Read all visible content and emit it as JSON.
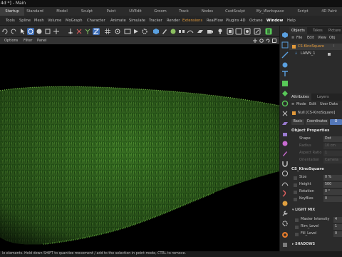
{
  "window": {
    "title": "4d *] - Main"
  },
  "layout_tabs": [
    {
      "label": "Startup",
      "active": true
    },
    {
      "label": "Standard"
    },
    {
      "label": "Model"
    },
    {
      "label": "Sculpt"
    },
    {
      "label": "Paint"
    },
    {
      "label": "UVEdit"
    },
    {
      "label": "Groom"
    },
    {
      "label": "Track"
    },
    {
      "label": "Nodes"
    },
    {
      "label": "CustSculpt"
    },
    {
      "label": "My_Workspace",
      "italic": true
    },
    {
      "label": "Script"
    },
    {
      "label": "4D Paint"
    }
  ],
  "menus": [
    "Tools",
    "Spline",
    "Mesh",
    "Volume",
    "MoGraph",
    "Character",
    "Animate",
    "Simulate",
    "Tracker",
    "Render",
    "Extensions",
    "RealFlow",
    "Plugins 4D",
    "Octane",
    "Window",
    "Help"
  ],
  "viewport": {
    "menu": [
      "Options",
      "Filter",
      "Panel"
    ]
  },
  "status": {
    "text": "le elements. Hold down SHIFT to quantize movement / add to the selection in point mode, CTRL to remove."
  },
  "objects_panel": {
    "tabs": [
      "Objects",
      "Takes",
      "Picture"
    ],
    "menu": [
      "File",
      "Edit",
      "View",
      "Obj"
    ],
    "items": [
      {
        "name": "CS-KinoSquare",
        "color": "#e39a3b",
        "selected": true
      },
      {
        "name": "LAWN_1",
        "color": "#cfcfcf"
      }
    ]
  },
  "attributes_panel": {
    "tabs": [
      "Attributes",
      "Layers"
    ],
    "menu": [
      "Mode",
      "Edit",
      "User Data"
    ],
    "object_line": "Null [CS-KinoSquare]",
    "subtabs": [
      {
        "label": "Basic"
      },
      {
        "label": "Coordinates"
      },
      {
        "label": "O",
        "active": true
      }
    ],
    "object_properties": {
      "title": "Object Properties",
      "rows": [
        {
          "label": "Shape",
          "value": "Dot",
          "dim": false
        },
        {
          "label": "Radius",
          "value": "10 cm",
          "dim": true
        },
        {
          "label": "Aspect Ratio",
          "value": "1",
          "dim": true
        },
        {
          "label": "Orientation",
          "value": "Camera",
          "dim": true
        }
      ]
    },
    "user_data": {
      "title": "CS_KinoSquare",
      "rows": [
        {
          "label": "Size",
          "value": "0 %"
        },
        {
          "label": "Height",
          "value": "500"
        },
        {
          "label": "Rotation",
          "value": "0 °"
        },
        {
          "label": "KeyBias",
          "value": "0"
        }
      ],
      "light_mix": {
        "title": "LIGHT MIX",
        "rows": [
          {
            "label": "Master Intensity",
            "value": "4"
          },
          {
            "label": "Rim_Level",
            "value": "1"
          },
          {
            "label": "Fill_Level",
            "value": "0"
          }
        ]
      },
      "shadows": {
        "title": "SHADOWS"
      }
    }
  },
  "colors": {
    "accent": "#e39a3b",
    "highlight": "#5377b8",
    "grass": "#2f6b1e"
  }
}
